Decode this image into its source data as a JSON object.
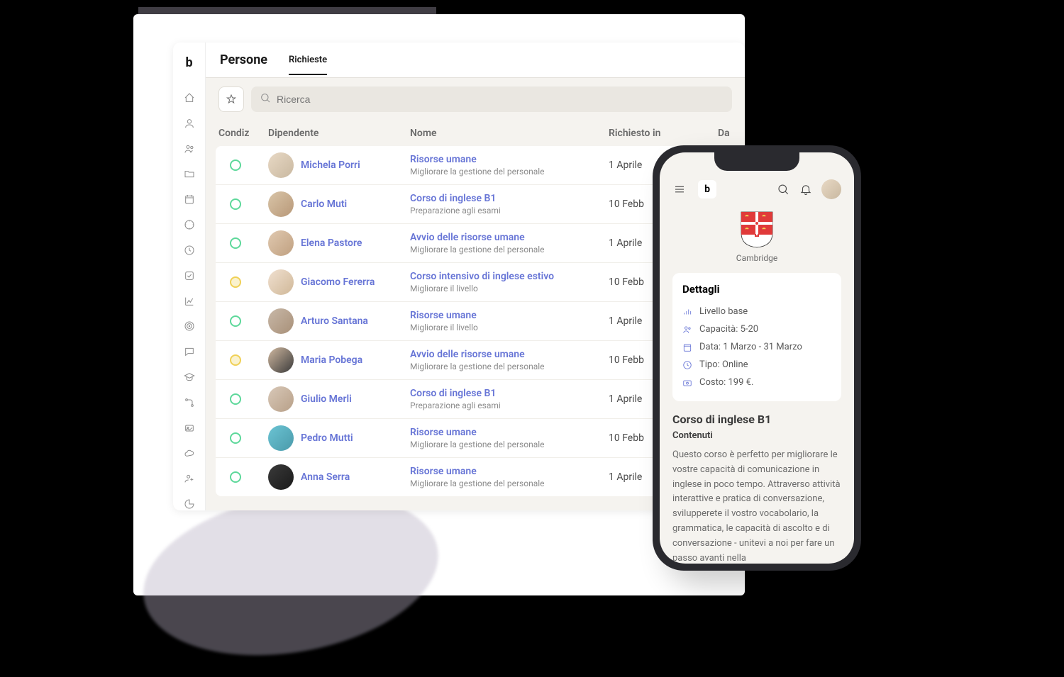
{
  "desktop": {
    "page_title": "Persone",
    "tab_label": "Richieste",
    "search_placeholder": "Ricerca",
    "columns": {
      "condiz": "Condiz",
      "dipendente": "Dipendente",
      "nome": "Nome",
      "richiesto": "Richiesto in",
      "da": "Da"
    },
    "rows": [
      {
        "status": "green",
        "employee": "Michela Porri",
        "title": "Risorse umane",
        "subtitle": "Migliorare la gestione del personale",
        "requested": "1 Aprile"
      },
      {
        "status": "green",
        "employee": "Carlo Muti",
        "title": "Corso di inglese B1",
        "subtitle": "Preparazione agli esami",
        "requested": "10 Febb"
      },
      {
        "status": "green",
        "employee": "Elena Pastore",
        "title": "Avvio delle risorse umane",
        "subtitle": "Migliorare la gestione del personale",
        "requested": "1 Aprile"
      },
      {
        "status": "yellow",
        "employee": "Giacomo Fererra",
        "title": "Corso intensivo di inglese estivo",
        "subtitle": "Migliorare il livello",
        "requested": "10 Febb"
      },
      {
        "status": "green",
        "employee": "Arturo Santana",
        "title": "Risorse umane",
        "subtitle": "Migliorare il livello",
        "requested": "1 Aprile"
      },
      {
        "status": "yellow",
        "employee": "Maria Pobega",
        "title": "Avvio delle risorse umane",
        "subtitle": "Migliorare la gestione del personale",
        "requested": "10 Febb"
      },
      {
        "status": "green",
        "employee": "Giulio Merli",
        "title": "Corso di inglese B1",
        "subtitle": "Preparazione agli esami",
        "requested": "1 Aprile"
      },
      {
        "status": "green",
        "employee": "Pedro Mutti",
        "title": "Risorse umane",
        "subtitle": "Migliorare la gestione del personale",
        "requested": "10 Febb"
      },
      {
        "status": "green",
        "employee": "Anna Serra",
        "title": "Risorse umane",
        "subtitle": "Migliorare la gestione del personale",
        "requested": "1 Aprile"
      }
    ]
  },
  "phone": {
    "crest_label": "Cambridge",
    "details_title": "Dettagli",
    "details": {
      "level": "Livello base",
      "capacity": "Capacità: 5-20",
      "date": "Data: 1 Marzo - 31 Marzo",
      "type": "Tipo: Online",
      "cost": "Costo: 199 €."
    },
    "course_title": "Corso di inglese B1",
    "course_subtitle": "Contenuti",
    "course_description": "Questo corso è perfetto per migliorare le vostre capacità di comunicazione in inglese in poco tempo. Attraverso attività interattive e pratica di conversazione, svilupperete il vostro vocabolario, la grammatica, le capacità di ascolto e di conversazione - unitevi a noi per fare un passo avanti nella"
  }
}
